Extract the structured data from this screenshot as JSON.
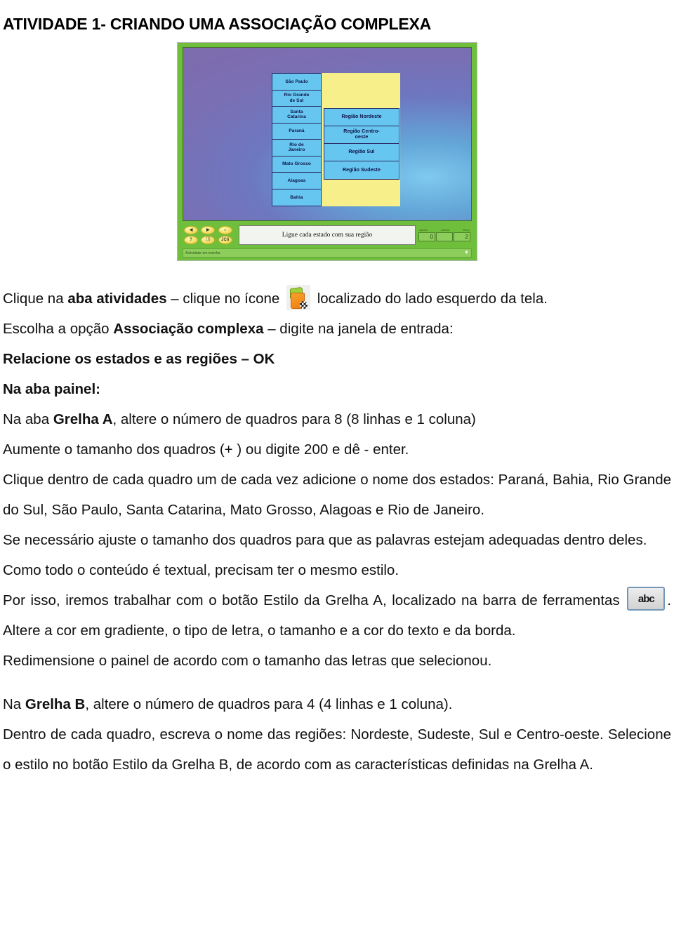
{
  "document": {
    "title": "ATIVIDADE 1- CRIANDO UMA ASSOCIAÇÃO COMPLEXA"
  },
  "screenshot": {
    "alt_name": "jclic-activity-screenshot",
    "message": "Ligue cada estado com sua região",
    "status_text": "Actividade em marcha",
    "counter_labels": {
      "hits": "aciertos",
      "attempts": "intentos",
      "time": "tempo"
    },
    "counters": {
      "hits": "0",
      "attempts": "",
      "time": "2"
    },
    "toolbar_buttons": [
      {
        "name": "previous-activity-button",
        "glyph": "◀"
      },
      {
        "name": "next-activity-button",
        "glyph": "▶"
      },
      {
        "name": "audio-button",
        "glyph": "∩"
      },
      {
        "name": "help-button",
        "glyph": "?"
      },
      {
        "name": "info-button",
        "glyph": "ⓘ"
      },
      {
        "name": "jclic-logo-button",
        "glyph": "JCli"
      }
    ],
    "grid_a": {
      "name": "grelha-a",
      "cells": [
        "São Paulo",
        "Rio Grande\nde Sul",
        "Santa\nCatarina",
        "Paraná",
        "Rio de\nJaneiro",
        "Mato Grosso",
        "Alagoas",
        "Bahia"
      ]
    },
    "grid_b": {
      "name": "grelha-b",
      "cells": [
        "Região Nordeste",
        "Região Centro-\noeste",
        "Região Sul",
        "Região Sudeste"
      ]
    },
    "colors": {
      "frame_green": "#6fbf3d",
      "cell_blue": "#66c6ef",
      "panel_yellow": "#f7f08a",
      "cell_text": "#101048"
    }
  },
  "paragraphs": {
    "p1_a": "Clique na ",
    "p1_b": "aba atividades",
    "p1_c": " – clique no ícone ",
    "p1_d": " localizado do lado esquerdo da tela.",
    "p2_a": "Escolha a opção ",
    "p2_b": "Associação complexa",
    "p2_c": " – digite na janela de entrada:",
    "p3": "Relacione os estados e as regiões – OK",
    "p4": "Na aba painel:",
    "p5_a": "Na aba ",
    "p5_b": "Grelha A",
    "p5_c": ", altere o número de quadros para 8 (8 linhas e 1 coluna)",
    "p6": "Aumente o tamanho dos quadros (+ ) ou digite 200 e dê  - enter.",
    "p7": "Clique dentro de cada quadro um de cada vez adicione o nome dos estados: Paraná, Bahia, Rio Grande do Sul, São Paulo, Santa Catarina, Mato Grosso, Alagoas e Rio de Janeiro.",
    "p8": "Se necessário ajuste o tamanho dos quadros para que as palavras estejam adequadas dentro deles.",
    "p9": "Como todo o conteúdo é textual, precisam ter o mesmo estilo.",
    "p10_a": "Por isso, iremos trabalhar com o botão Estilo da Grelha A, localizado na barra de ferramentas ",
    "p10_b": ". Altere a cor em gradiente, o tipo de letra, o tamanho e a cor do texto e da borda.",
    "p11": "Redimensione o painel de acordo com o tamanho das letras que selecionou.",
    "p12_a": "Na ",
    "p12_b": "Grelha B",
    "p12_c": ", altere o número de quadros para 4 (4 linhas e 1 coluna).",
    "p13": "Dentro de cada quadro, escreva o nome das regiões: Nordeste, Sudeste, Sul e Centro-oeste. Selecione o estilo no botão Estilo da Grelha B, de acordo com as características definidas na Grelha A.",
    "abc_button_label": "abc"
  }
}
